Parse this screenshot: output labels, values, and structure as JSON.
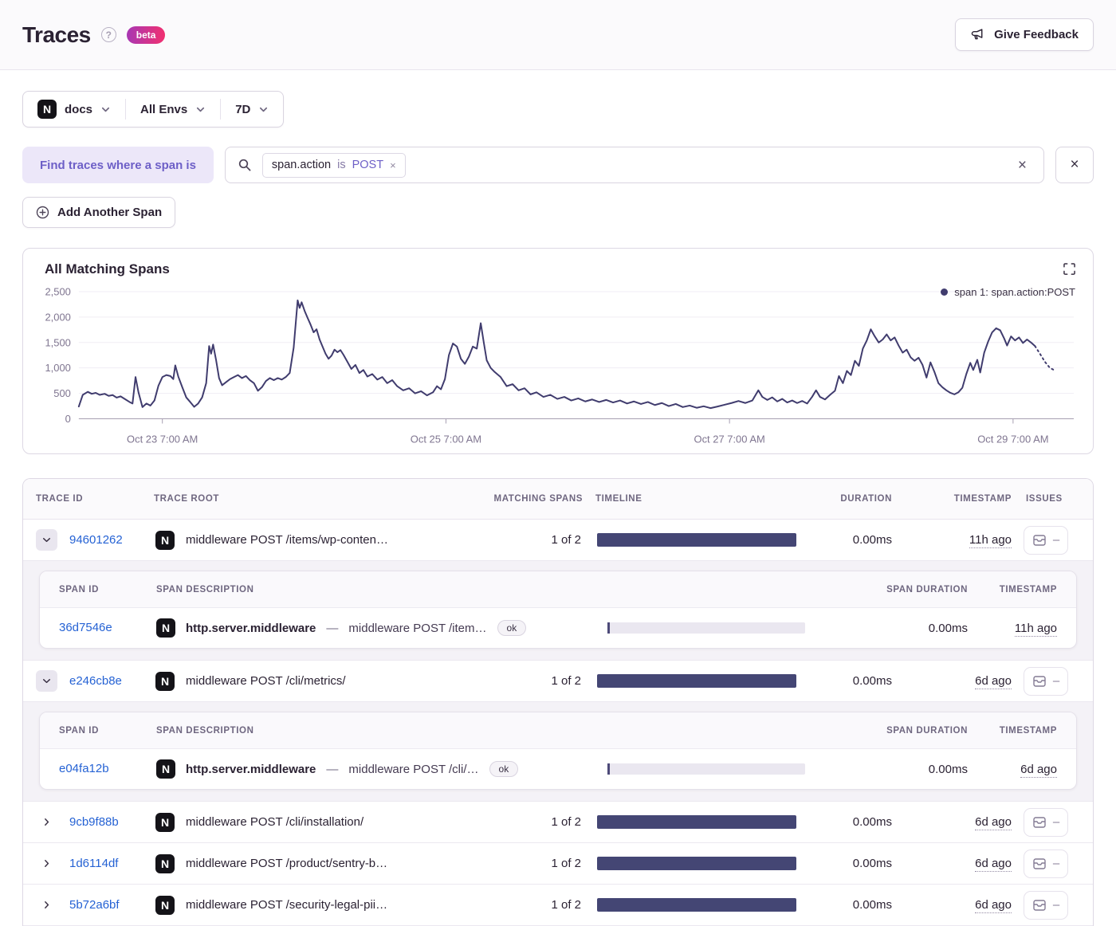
{
  "header": {
    "title": "Traces",
    "beta_label": "beta",
    "feedback_label": "Give Feedback"
  },
  "filters": {
    "project": "docs",
    "project_platform_initial": "N",
    "environment": "All Envs",
    "period": "7D"
  },
  "query": {
    "find_label": "Find traces where a span is",
    "token": {
      "key": "span.action",
      "operator": "is",
      "value": "POST",
      "remove_glyph": "×"
    },
    "add_span_label": "Add Another Span"
  },
  "chart": {
    "title": "All Matching Spans",
    "legend": "span 1: span.action:POST"
  },
  "chart_data": {
    "type": "line",
    "title": "All Matching Spans",
    "ylabel": "",
    "xlabel": "",
    "ylim": [
      0,
      2500
    ],
    "yticks": [
      0,
      500,
      1000,
      1500,
      2000,
      2500
    ],
    "grid": "horizontal",
    "legend_position": "top-right",
    "xticks": [
      {
        "pos": 0.084,
        "label": "Oct 23 7:00 AM"
      },
      {
        "pos": 0.369,
        "label": "Oct 25 7:00 AM"
      },
      {
        "pos": 0.654,
        "label": "Oct 27 7:00 AM"
      },
      {
        "pos": 0.939,
        "label": "Oct 29 7:00 AM"
      }
    ],
    "series": [
      {
        "name": "span 1: span.action:POST",
        "points": [
          [
            0.0,
            240
          ],
          [
            0.004,
            470
          ],
          [
            0.009,
            530
          ],
          [
            0.013,
            490
          ],
          [
            0.017,
            510
          ],
          [
            0.021,
            470
          ],
          [
            0.026,
            490
          ],
          [
            0.03,
            450
          ],
          [
            0.034,
            465
          ],
          [
            0.038,
            415
          ],
          [
            0.042,
            440
          ],
          [
            0.047,
            380
          ],
          [
            0.051,
            330
          ],
          [
            0.054,
            300
          ],
          [
            0.057,
            820
          ],
          [
            0.06,
            520
          ],
          [
            0.064,
            230
          ],
          [
            0.068,
            300
          ],
          [
            0.072,
            260
          ],
          [
            0.076,
            360
          ],
          [
            0.08,
            650
          ],
          [
            0.084,
            820
          ],
          [
            0.088,
            860
          ],
          [
            0.092,
            840
          ],
          [
            0.095,
            780
          ],
          [
            0.097,
            1050
          ],
          [
            0.1,
            830
          ],
          [
            0.104,
            620
          ],
          [
            0.108,
            420
          ],
          [
            0.112,
            330
          ],
          [
            0.116,
            235
          ],
          [
            0.12,
            300
          ],
          [
            0.124,
            420
          ],
          [
            0.128,
            700
          ],
          [
            0.131,
            1430
          ],
          [
            0.133,
            1280
          ],
          [
            0.135,
            1460
          ],
          [
            0.138,
            1150
          ],
          [
            0.141,
            800
          ],
          [
            0.144,
            660
          ],
          [
            0.148,
            720
          ],
          [
            0.152,
            780
          ],
          [
            0.156,
            820
          ],
          [
            0.16,
            860
          ],
          [
            0.164,
            800
          ],
          [
            0.168,
            840
          ],
          [
            0.172,
            760
          ],
          [
            0.176,
            700
          ],
          [
            0.18,
            550
          ],
          [
            0.184,
            620
          ],
          [
            0.188,
            740
          ],
          [
            0.192,
            800
          ],
          [
            0.196,
            760
          ],
          [
            0.2,
            800
          ],
          [
            0.204,
            770
          ],
          [
            0.208,
            820
          ],
          [
            0.212,
            900
          ],
          [
            0.216,
            1400
          ],
          [
            0.22,
            2330
          ],
          [
            0.222,
            2180
          ],
          [
            0.224,
            2290
          ],
          [
            0.227,
            2120
          ],
          [
            0.23,
            1980
          ],
          [
            0.233,
            1850
          ],
          [
            0.236,
            1700
          ],
          [
            0.239,
            1760
          ],
          [
            0.242,
            1560
          ],
          [
            0.245,
            1420
          ],
          [
            0.248,
            1280
          ],
          [
            0.251,
            1180
          ],
          [
            0.254,
            1240
          ],
          [
            0.257,
            1360
          ],
          [
            0.26,
            1310
          ],
          [
            0.263,
            1350
          ],
          [
            0.266,
            1260
          ],
          [
            0.27,
            1120
          ],
          [
            0.274,
            980
          ],
          [
            0.278,
            1060
          ],
          [
            0.282,
            900
          ],
          [
            0.286,
            960
          ],
          [
            0.29,
            830
          ],
          [
            0.295,
            880
          ],
          [
            0.3,
            770
          ],
          [
            0.305,
            820
          ],
          [
            0.31,
            700
          ],
          [
            0.315,
            760
          ],
          [
            0.32,
            640
          ],
          [
            0.326,
            560
          ],
          [
            0.332,
            600
          ],
          [
            0.338,
            500
          ],
          [
            0.344,
            540
          ],
          [
            0.35,
            460
          ],
          [
            0.356,
            520
          ],
          [
            0.36,
            640
          ],
          [
            0.364,
            580
          ],
          [
            0.368,
            780
          ],
          [
            0.372,
            1250
          ],
          [
            0.376,
            1480
          ],
          [
            0.38,
            1420
          ],
          [
            0.384,
            1180
          ],
          [
            0.388,
            1080
          ],
          [
            0.392,
            1220
          ],
          [
            0.396,
            1420
          ],
          [
            0.4,
            1380
          ],
          [
            0.404,
            1880
          ],
          [
            0.407,
            1500
          ],
          [
            0.41,
            1150
          ],
          [
            0.414,
            1000
          ],
          [
            0.418,
            920
          ],
          [
            0.424,
            820
          ],
          [
            0.43,
            640
          ],
          [
            0.436,
            680
          ],
          [
            0.442,
            560
          ],
          [
            0.448,
            600
          ],
          [
            0.454,
            480
          ],
          [
            0.46,
            520
          ],
          [
            0.467,
            430
          ],
          [
            0.474,
            470
          ],
          [
            0.481,
            390
          ],
          [
            0.488,
            430
          ],
          [
            0.495,
            360
          ],
          [
            0.502,
            400
          ],
          [
            0.509,
            340
          ],
          [
            0.516,
            380
          ],
          [
            0.523,
            330
          ],
          [
            0.53,
            370
          ],
          [
            0.537,
            320
          ],
          [
            0.544,
            360
          ],
          [
            0.551,
            300
          ],
          [
            0.558,
            340
          ],
          [
            0.565,
            290
          ],
          [
            0.572,
            330
          ],
          [
            0.579,
            270
          ],
          [
            0.586,
            310
          ],
          [
            0.593,
            250
          ],
          [
            0.6,
            290
          ],
          [
            0.607,
            230
          ],
          [
            0.614,
            260
          ],
          [
            0.621,
            215
          ],
          [
            0.628,
            245
          ],
          [
            0.635,
            210
          ],
          [
            0.642,
            240
          ],
          [
            0.649,
            275
          ],
          [
            0.656,
            310
          ],
          [
            0.663,
            350
          ],
          [
            0.67,
            310
          ],
          [
            0.677,
            360
          ],
          [
            0.683,
            560
          ],
          [
            0.687,
            430
          ],
          [
            0.692,
            370
          ],
          [
            0.697,
            420
          ],
          [
            0.702,
            340
          ],
          [
            0.707,
            390
          ],
          [
            0.712,
            320
          ],
          [
            0.717,
            360
          ],
          [
            0.722,
            310
          ],
          [
            0.727,
            350
          ],
          [
            0.732,
            300
          ],
          [
            0.737,
            430
          ],
          [
            0.741,
            560
          ],
          [
            0.745,
            430
          ],
          [
            0.75,
            380
          ],
          [
            0.755,
            470
          ],
          [
            0.76,
            550
          ],
          [
            0.764,
            840
          ],
          [
            0.768,
            700
          ],
          [
            0.772,
            940
          ],
          [
            0.776,
            860
          ],
          [
            0.78,
            1140
          ],
          [
            0.784,
            1040
          ],
          [
            0.788,
            1380
          ],
          [
            0.792,
            1540
          ],
          [
            0.796,
            1760
          ],
          [
            0.8,
            1620
          ],
          [
            0.804,
            1500
          ],
          [
            0.808,
            1560
          ],
          [
            0.812,
            1660
          ],
          [
            0.816,
            1540
          ],
          [
            0.82,
            1600
          ],
          [
            0.824,
            1440
          ],
          [
            0.828,
            1300
          ],
          [
            0.832,
            1360
          ],
          [
            0.836,
            1210
          ],
          [
            0.84,
            1140
          ],
          [
            0.844,
            1200
          ],
          [
            0.848,
            1060
          ],
          [
            0.852,
            810
          ],
          [
            0.856,
            1110
          ],
          [
            0.86,
            920
          ],
          [
            0.864,
            700
          ],
          [
            0.868,
            620
          ],
          [
            0.872,
            560
          ],
          [
            0.876,
            510
          ],
          [
            0.88,
            480
          ],
          [
            0.884,
            520
          ],
          [
            0.888,
            610
          ],
          [
            0.892,
            880
          ],
          [
            0.896,
            1100
          ],
          [
            0.899,
            960
          ],
          [
            0.903,
            1160
          ],
          [
            0.906,
            910
          ],
          [
            0.91,
            1300
          ],
          [
            0.914,
            1520
          ],
          [
            0.918,
            1700
          ],
          [
            0.922,
            1780
          ],
          [
            0.926,
            1740
          ],
          [
            0.93,
            1580
          ],
          [
            0.933,
            1440
          ],
          [
            0.937,
            1620
          ],
          [
            0.941,
            1540
          ],
          [
            0.945,
            1600
          ],
          [
            0.949,
            1490
          ],
          [
            0.953,
            1560
          ],
          [
            0.957,
            1500
          ],
          [
            0.961,
            1430
          ]
        ]
      }
    ],
    "dashed_tail_points": [
      [
        0.961,
        1430
      ],
      [
        0.966,
        1280
      ],
      [
        0.971,
        1120
      ],
      [
        0.976,
        1000
      ],
      [
        0.981,
        950
      ]
    ]
  },
  "table": {
    "columns": [
      "TRACE ID",
      "TRACE ROOT",
      "MATCHING SPANS",
      "TIMELINE",
      "DURATION",
      "TIMESTAMP",
      "ISSUES"
    ],
    "span_columns": [
      "SPAN ID",
      "SPAN DESCRIPTION",
      "SPAN DURATION",
      "TIMESTAMP"
    ],
    "rows": [
      {
        "trace_id": "94601262",
        "expanded": true,
        "root": "middleware POST /items/wp-conten…",
        "matching": "1 of 2",
        "duration": "0.00ms",
        "timestamp": "11h ago",
        "spans": [
          {
            "span_id": "36d7546e",
            "op": "http.server.middleware",
            "desc": "middleware POST /item…",
            "status": "ok",
            "duration": "0.00ms",
            "timestamp": "11h ago"
          }
        ]
      },
      {
        "trace_id": "e246cb8e",
        "expanded": true,
        "root": "middleware POST /cli/metrics/",
        "matching": "1 of 2",
        "duration": "0.00ms",
        "timestamp": "6d ago",
        "spans": [
          {
            "span_id": "e04fa12b",
            "op": "http.server.middleware",
            "desc": "middleware POST /cli/…",
            "status": "ok",
            "duration": "0.00ms",
            "timestamp": "6d ago"
          }
        ]
      },
      {
        "trace_id": "9cb9f88b",
        "expanded": false,
        "root": "middleware POST /cli/installation/",
        "matching": "1 of 2",
        "duration": "0.00ms",
        "timestamp": "6d ago",
        "spans": []
      },
      {
        "trace_id": "1d6114df",
        "expanded": false,
        "root": "middleware POST /product/sentry-b…",
        "matching": "1 of 2",
        "duration": "0.00ms",
        "timestamp": "6d ago",
        "spans": []
      },
      {
        "trace_id": "5b72a6bf",
        "expanded": false,
        "root": "middleware POST /security-legal-pii…",
        "matching": "1 of 2",
        "duration": "0.00ms",
        "timestamp": "6d ago",
        "spans": []
      }
    ]
  },
  "colors": {
    "accent_purple": "#6d5fc7",
    "link_blue": "#2562d4",
    "chart_line": "#403c6e",
    "timeline_bar": "#444674",
    "beta_gradient_start": "#a737b4",
    "beta_gradient_end": "#f2306f"
  }
}
